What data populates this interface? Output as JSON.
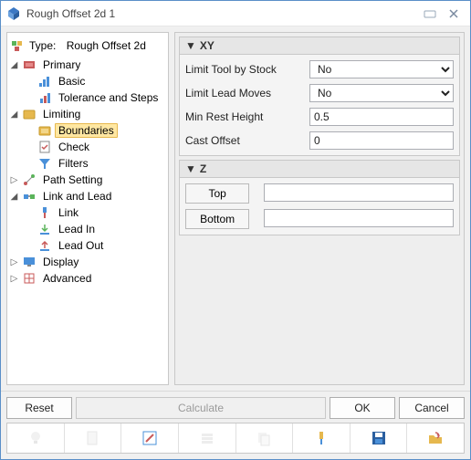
{
  "window": {
    "title": "Rough Offset 2d 1"
  },
  "type_row": {
    "prefix": "Type:",
    "value": "Rough Offset 2d"
  },
  "tree": {
    "primary": "Primary",
    "basic": "Basic",
    "tolerance": "Tolerance and Steps",
    "limiting": "Limiting",
    "boundaries": "Boundaries",
    "check": "Check",
    "filters": "Filters",
    "path_setting": "Path Setting",
    "link_and_lead": "Link and Lead",
    "link": "Link",
    "lead_in": "Lead In",
    "lead_out": "Lead Out",
    "display": "Display",
    "advanced": "Advanced"
  },
  "xy": {
    "header": "XY",
    "limit_tool_label": "Limit Tool by Stock",
    "limit_tool_value": "No",
    "limit_lead_label": "Limit Lead Moves",
    "limit_lead_value": "No",
    "min_rest_label": "Min Rest Height",
    "min_rest_value": "0.5",
    "cast_offset_label": "Cast Offset",
    "cast_offset_value": "0"
  },
  "z": {
    "header": "Z",
    "top_label": "Top",
    "top_value": "",
    "bottom_label": "Bottom",
    "bottom_value": ""
  },
  "footer": {
    "reset": "Reset",
    "calculate": "Calculate",
    "ok": "OK",
    "cancel": "Cancel"
  }
}
